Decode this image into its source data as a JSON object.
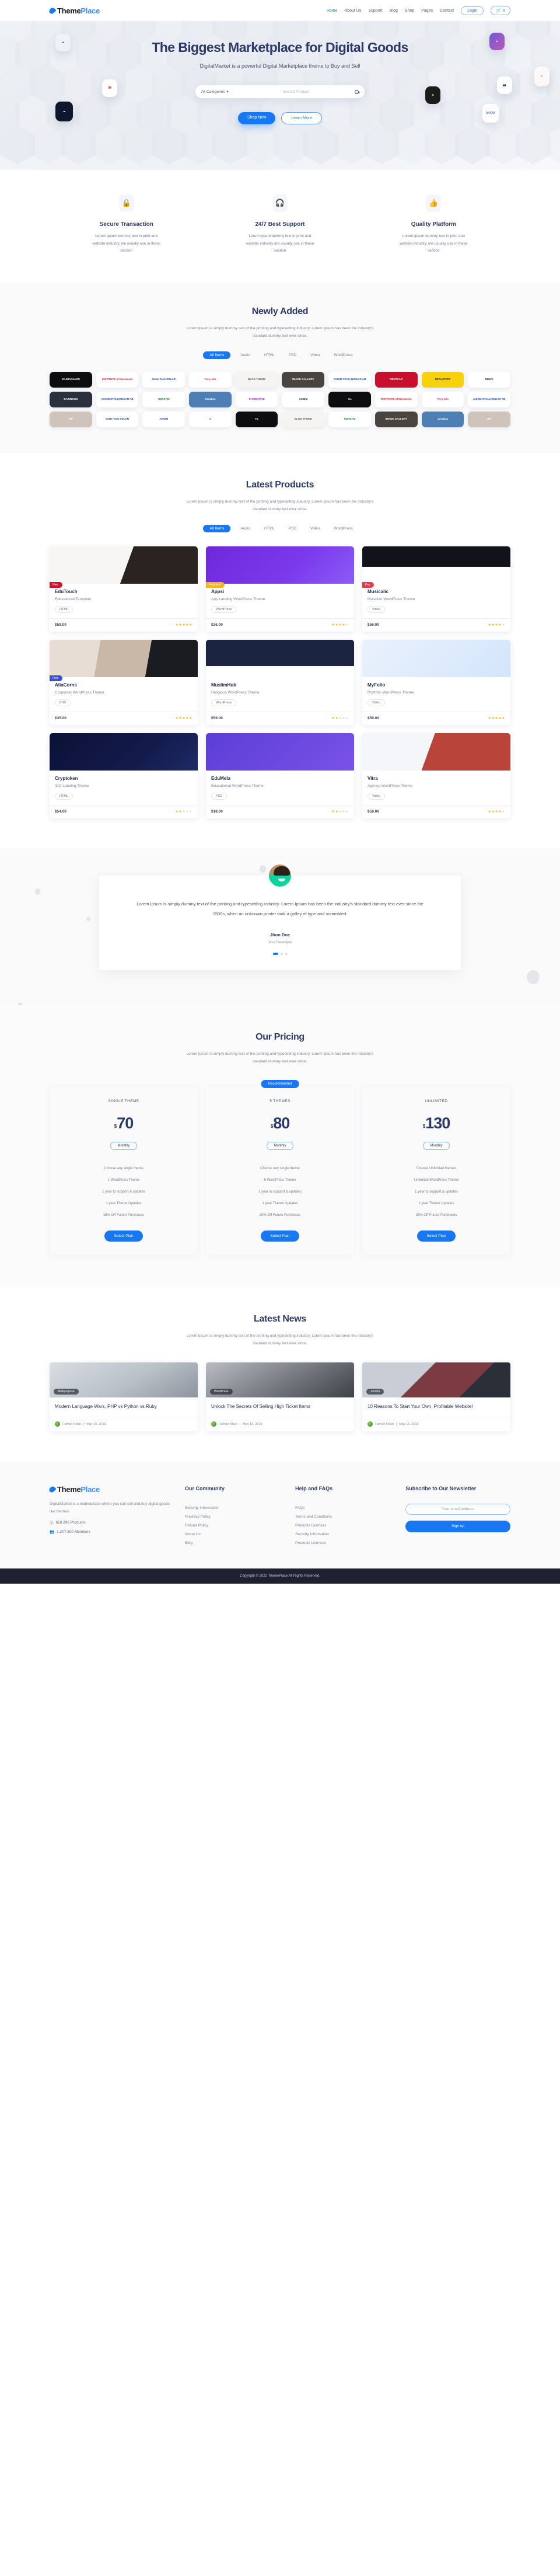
{
  "brand": {
    "name_part1": "Theme",
    "name_part2": "Place"
  },
  "header": {
    "nav": [
      {
        "label": "Home",
        "active": true
      },
      {
        "label": "About Us",
        "active": false
      },
      {
        "label": "Support",
        "active": false
      },
      {
        "label": "Blog",
        "active": false
      },
      {
        "label": "Shop",
        "active": false
      },
      {
        "label": "Pages",
        "active": false
      },
      {
        "label": "Contact",
        "active": false
      }
    ],
    "login_label": "Login",
    "cart_count": "0"
  },
  "hero": {
    "title": "The Biggest Marketplace for Digital Goods",
    "subtitle": "DigitalMarket is a powerful Digital Marketplace theme to Buy and Sell",
    "category_label": "All Categories",
    "search_placeholder": "Search Product",
    "primary_button": "Shop Now",
    "secondary_button": "Learn More"
  },
  "features": [
    {
      "icon": "lock-icon",
      "glyph": "🔒",
      "title": "Secure Transaction",
      "text": "Lorem ipsum dummy text in print and website industry are usually use in these section"
    },
    {
      "icon": "headset-icon",
      "glyph": "🎧",
      "title": "24/7 Best Support",
      "text": "Lorem ipsum dummy text in print and website industry are usually use in these section"
    },
    {
      "icon": "thumbs-up-icon",
      "glyph": "👍",
      "title": "Quality Platform",
      "text": "Lorem ipsum dummy text in print and website industry are usually use in these section"
    }
  ],
  "newly_added": {
    "title": "Newly Added",
    "subtitle": "Lorem Ipsum is simply dummy text of the printing and typesetting industry. Lorem Ipsum has been the industry's standard dummy text ever since.",
    "tabs": [
      "All Items",
      "Audio",
      "HTML",
      "PSD",
      "Video",
      "WordPress"
    ],
    "active_tab": "All Items",
    "items": [
      {
        "label": "KILIMANJARO",
        "bg": "#0d0d0f",
        "fg": "#ffffff"
      },
      {
        "label": "INSTITUTE of Movement",
        "bg": "#ffffff",
        "fg": "#c4232b"
      },
      {
        "label": "SoHo Tech SOLAR",
        "bg": "#ffffff",
        "fg": "#1a3f8f"
      },
      {
        "label": "Pony Mia",
        "bg": "#ffffff",
        "fg": "#e6357f"
      },
      {
        "label": "BLOG THEME",
        "bg": "#f6f4f2",
        "fg": "#5c5a58"
      },
      {
        "label": "IMAGE GALLERY",
        "bg": "#4a4440",
        "fg": "#ffffff"
      },
      {
        "label": "AXIOM STALLNINGAR AB",
        "bg": "#ffffff",
        "fg": "#1b4fa8"
      },
      {
        "label": "RENTCAR",
        "bg": "#c8102e",
        "fg": "#ffffff"
      },
      {
        "label": "REALSTATE",
        "bg": "#f7d20a",
        "fg": "#2a2a2a"
      },
      {
        "label": "NIMVA",
        "bg": "#ffffff",
        "fg": "#16181d"
      },
      {
        "label": "BAZINEWS",
        "bg": "#2a303c",
        "fg": "#ffffff"
      },
      {
        "label": "AXIOM STALLNINGAR AB",
        "bg": "#ffffff",
        "fg": "#1b4fa8"
      },
      {
        "label": "HDREAM",
        "bg": "#ffffff",
        "fg": "#2d8a3e"
      },
      {
        "label": "Creatica",
        "bg": "#4d7fb5",
        "fg": "#ffffff"
      },
      {
        "label": "C CREATIVE",
        "bg": "#ffffff",
        "fg": "#a0229b"
      },
      {
        "label": "AXIOM",
        "bg": "#ffffff",
        "fg": "#16181d"
      },
      {
        "label": "Yo.",
        "bg": "#0d0d0f",
        "fg": "#ffffff"
      },
      {
        "label": "INSTITUTE of Movement",
        "bg": "#ffffff",
        "fg": "#c4232b"
      },
      {
        "label": "Pony Mia",
        "bg": "#ffffff",
        "fg": "#e6357f"
      },
      {
        "label": "AXIOM STALLNINGAR AB",
        "bg": "#ffffff",
        "fg": "#1b4fa8"
      },
      {
        "label": "WP",
        "bg": "#cfc4bc",
        "fg": "#ffffff"
      },
      {
        "label": "SoHo Tech SOLAR",
        "bg": "#ffffff",
        "fg": "#1a3f8f"
      },
      {
        "label": "AXIOM",
        "bg": "#ffffff",
        "fg": "#1b4fa8"
      },
      {
        "label": "C",
        "bg": "#ffffff",
        "fg": "#a0229b"
      },
      {
        "label": "Yo.",
        "bg": "#0d0d0f",
        "fg": "#ffffff"
      },
      {
        "label": "BLOG THEME",
        "bg": "#f6f4f2",
        "fg": "#5c5a58"
      },
      {
        "label": "HDREAM",
        "bg": "#ffffff",
        "fg": "#2d8a3e"
      },
      {
        "label": "IMAGE GALLERY",
        "bg": "#4a4440",
        "fg": "#ffffff"
      },
      {
        "label": "Creatica",
        "bg": "#4d7fb5",
        "fg": "#ffffff"
      },
      {
        "label": "WP",
        "bg": "#cfc4bc",
        "fg": "#ffffff"
      }
    ]
  },
  "latest_products": {
    "title": "Latest Products",
    "subtitle": "Lorem Ipsum is simply dummy text of the printing and typesetting industry. Lorem Ipsum has been the industry's standard dummy text ever since.",
    "tabs": [
      "All Items",
      "Audio",
      "HTML",
      "PSD",
      "Video",
      "WordPress"
    ],
    "active_tab": "All Items",
    "items": [
      {
        "name": "EduTouch",
        "sub": "Educational Template",
        "tag": "HTML",
        "price": "$59.00",
        "rating": 5,
        "badge": "New",
        "badge_color": "#d6112a",
        "thumb": "edutouch"
      },
      {
        "name": "Appsi",
        "sub": "App Landing WordPress Theme",
        "tag": "WordPress",
        "price": "$36.00",
        "rating": 4,
        "badge": "Featured",
        "badge_color": "#f5b81c",
        "thumb": "appsi"
      },
      {
        "name": "Musicalic",
        "sub": "Musician WordPress Theme",
        "tag": "Video",
        "price": "$56.00",
        "rating": 4,
        "badge": "Pro",
        "badge_color": "#e83b4a",
        "thumb": "musicalic"
      },
      {
        "name": "AliaCorns",
        "sub": "Corporate WordPress Theme",
        "tag": "PSD",
        "price": "$35.00",
        "rating": 5,
        "badge": "Free",
        "badge_color": "#3a52c6",
        "thumb": "aliacorns"
      },
      {
        "name": "MuslimHub",
        "sub": "Religious WordPress Theme",
        "tag": "WordPress",
        "price": "$59.00",
        "rating": 2,
        "badge": "",
        "badge_color": "",
        "thumb": "muslimhub"
      },
      {
        "name": "MyFolio",
        "sub": "Portfolio WordPress Theme",
        "tag": "Video",
        "price": "$59.00",
        "rating": 5,
        "badge": "",
        "badge_color": "",
        "thumb": "myfolio"
      },
      {
        "name": "Cryptoken",
        "sub": "ICO Landing Theme",
        "tag": "HTML",
        "price": "$54.00",
        "rating": 2,
        "badge": "",
        "badge_color": "",
        "thumb": "cryptoken"
      },
      {
        "name": "EduMela",
        "sub": "Educational WordPress Theme",
        "tag": "PSD",
        "price": "$18.00",
        "rating": 2,
        "badge": "",
        "badge_color": "",
        "thumb": "edumela"
      },
      {
        "name": "Vitra",
        "sub": "Agency WordPress Theme",
        "tag": "Video",
        "price": "$59.00",
        "rating": 4,
        "badge": "",
        "badge_color": "",
        "thumb": "vitra"
      }
    ]
  },
  "testimonial": {
    "quote": "Lorem Ipsum is simply dummy text of the printing and typesetting industry. Lorem Ipsum has been the industry's standard dummy text ever since the 1500s, when an unknown printer took a galley of type and scrambled.",
    "name": "Jhon Doe",
    "role": "Java Developer"
  },
  "pricing": {
    "title": "Our Pricing",
    "subtitle": "Lorem Ipsum is simply dummy text of the printing and typesetting industry. Lorem ipsum has been the industry's standard dummy text ever since.",
    "recommended_label": "Recommended",
    "plans": [
      {
        "plan": "SINGLE THEME",
        "currency": "$",
        "amount": "70",
        "cycle": "Monthly",
        "features": [
          "Choose any single theme",
          "1 WordPress Theme",
          "1 year to support & updates",
          "1 year Theme Updates",
          "15% Off Future Purchases"
        ],
        "cta": "Select Plan",
        "recommended": false
      },
      {
        "plan": "5 THEMES",
        "currency": "$",
        "amount": "80",
        "cycle": "Monthly",
        "features": [
          "Choose any single theme",
          "5 WordPress Theme",
          "1 year to support & updates",
          "1 year Theme Updates",
          "20% Off Future Purchases"
        ],
        "cta": "Select Plan",
        "recommended": true
      },
      {
        "plan": "UNLIMITED",
        "currency": "$",
        "amount": "130",
        "cycle": "Monthly",
        "features": [
          "Choose Unlimited themes",
          "Unlimited WordPress Theme",
          "1 year to support & updates",
          "1 year Theme Updates",
          "25% Off Future Purchases"
        ],
        "cta": "Select Plan",
        "recommended": false
      }
    ]
  },
  "news": {
    "title": "Latest News",
    "subtitle": "Lorem Ipsum is simply dummy text of the printing and typesetting industry. Lorem ipsum has been the industry's standard dummy text ever since.",
    "items": [
      {
        "category": "Multipurpose",
        "title": "Modern Language Wars, PHP vs Python vs Ruby",
        "author": "Farhan Khan",
        "date": "May 15, 2019",
        "thumb": "desk"
      },
      {
        "category": "WordPress",
        "title": "Unlock The Secrets Of Selling High Ticket Items",
        "author": "Farhan Khan",
        "date": "May 15, 2019",
        "thumb": "laptop"
      },
      {
        "category": "Joomla",
        "title": "10 Reasons To Start Your Own, Profitable Website!",
        "author": "Farhan Khan",
        "date": "May 15, 2019",
        "thumb": "office"
      }
    ]
  },
  "footer": {
    "about_text": "DigitalMarket is a marketplace where you can sell and buy digital goods like themes",
    "stat_products": "850.296 Products",
    "stat_members": "1.207.300 Members",
    "community": {
      "title": "Our Community",
      "links": [
        "Security Information",
        "Priveacy Policy",
        "Refund Policy",
        "About Us",
        "Blog"
      ]
    },
    "help": {
      "title": "Help and FAQs",
      "links": [
        "FAQs",
        "Terms and Conditions",
        "Products Licenses",
        "Security Information",
        "Products Licenses"
      ]
    },
    "newsletter": {
      "title": "Subscribe to Our Newsletter",
      "placeholder": "Your email address",
      "button": "Sign up"
    },
    "copyright": "Copyright © 2022 ThemePlace All Rights Reserved."
  },
  "colors": {
    "accent": "#1877f2",
    "dark_navy": "#2b3a67",
    "star_on": "#ffb400",
    "footer_bar": "#1e2230"
  }
}
